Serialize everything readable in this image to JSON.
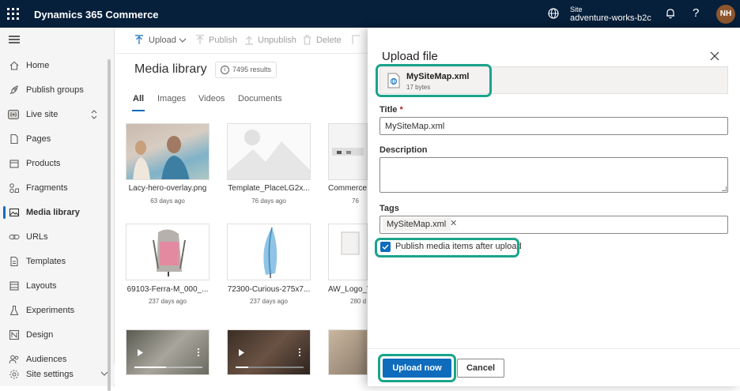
{
  "app": {
    "name": "Dynamics 365 Commerce",
    "site_label": "Site",
    "site_name": "adventure-works-b2c",
    "help": "?",
    "avatar": "NH"
  },
  "sidebar": {
    "items": [
      {
        "label": "Home",
        "icon": "home-icon"
      },
      {
        "label": "Publish groups",
        "icon": "rocket-icon"
      },
      {
        "label": "Live site",
        "icon": "broadcast-icon"
      },
      {
        "label": "Pages",
        "icon": "page-icon"
      },
      {
        "label": "Products",
        "icon": "box-icon"
      },
      {
        "label": "Fragments",
        "icon": "fragment-icon"
      },
      {
        "label": "Media library",
        "icon": "image-icon",
        "active": true
      },
      {
        "label": "URLs",
        "icon": "link-icon"
      },
      {
        "label": "Templates",
        "icon": "template-icon"
      },
      {
        "label": "Layouts",
        "icon": "layout-icon"
      },
      {
        "label": "Experiments",
        "icon": "flask-icon"
      },
      {
        "label": "Design",
        "icon": "design-icon"
      },
      {
        "label": "Audiences",
        "icon": "people-icon"
      }
    ],
    "settings": "Site settings"
  },
  "toolbar": {
    "upload": "Upload",
    "publish": "Publish",
    "unpublish": "Unpublish",
    "delete": "Delete"
  },
  "library": {
    "title": "Media library",
    "count": "7495 results",
    "tabs": [
      "All",
      "Images",
      "Videos",
      "Documents"
    ],
    "items": [
      {
        "name": "Lacy-hero-overlay.png",
        "age": "63 days ago"
      },
      {
        "name": "Template_PlaceLG2x...",
        "age": "76 days ago"
      },
      {
        "name": "Commerce",
        "age": "76"
      },
      {
        "name": "69103-Ferra-M_000_...",
        "age": "237 days ago"
      },
      {
        "name": "72300-Curious-275x7...",
        "age": "237 days ago"
      },
      {
        "name": "AW_Logo_V",
        "age": "280 d"
      }
    ]
  },
  "dialog": {
    "title": "Upload file",
    "file_name": "MySiteMap.xml",
    "file_size": "17 bytes",
    "title_label": "Title",
    "title_required": "*",
    "title_value": "MySiteMap.xml",
    "description_label": "Description",
    "description_value": "",
    "tags_label": "Tags",
    "tag": "MySiteMap.xml",
    "publish_label": "Publish media items after upload",
    "publish_checked": true,
    "upload_button": "Upload now",
    "cancel_button": "Cancel"
  },
  "colors": {
    "topbar": "#061f3a",
    "primary": "#0f6cbd",
    "highlight": "#1aa48a"
  }
}
